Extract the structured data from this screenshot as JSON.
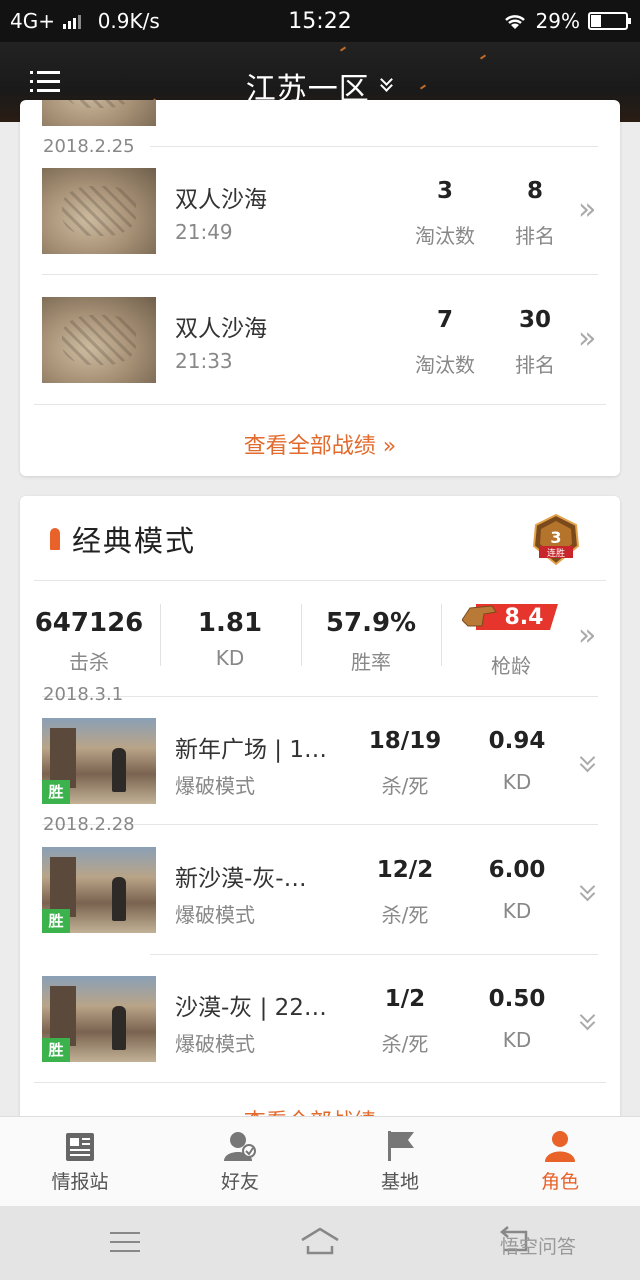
{
  "status": {
    "network": "4G+",
    "speed": "0.9K/s",
    "time": "15:22",
    "battery": "29%",
    "battery_level": 0.29
  },
  "header": {
    "title": "江苏一区"
  },
  "ranked": {
    "top_date": "2018.2.25",
    "col_kills": "淘汰数",
    "col_rank": "排名",
    "rows": [
      {
        "name": "双人沙海",
        "time": "21:49",
        "kills": "3",
        "rank": "8"
      },
      {
        "name": "双人沙海",
        "time": "21:33",
        "kills": "7",
        "rank": "30"
      }
    ],
    "view_all": "查看全部战绩 »"
  },
  "classic": {
    "title": "经典模式",
    "streak": {
      "num": "3",
      "label": "连胜"
    },
    "summary": [
      {
        "value": "647126",
        "label": "击杀"
      },
      {
        "value": "1.81",
        "label": "KD"
      },
      {
        "value": "57.9%",
        "label": "胜率"
      },
      {
        "value": "8.4",
        "label": "枪龄"
      }
    ],
    "win_label": "胜",
    "col_kd_ratio": "杀/死",
    "col_kd": "KD",
    "matches": [
      {
        "date": "2018.3.1",
        "name": "新年广场 | 1…",
        "mode": "爆破模式",
        "kd_ratio": "18/19",
        "kd": "0.94"
      },
      {
        "date": "2018.2.28",
        "name": "新沙漠-灰-…",
        "mode": "爆破模式",
        "kd_ratio": "12/2",
        "kd": "6.00"
      },
      {
        "date": "",
        "name": "沙漠-灰 | 22…",
        "mode": "爆破模式",
        "kd_ratio": "1/2",
        "kd": "0.50"
      }
    ],
    "view_all": "查看全部战绩 »"
  },
  "tabs": [
    {
      "label": "情报站"
    },
    {
      "label": "好友"
    },
    {
      "label": "基地"
    },
    {
      "label": "角色"
    }
  ],
  "watermark": "悟空问答",
  "colors": {
    "accent": "#e8622a",
    "win": "#3bb24b"
  }
}
